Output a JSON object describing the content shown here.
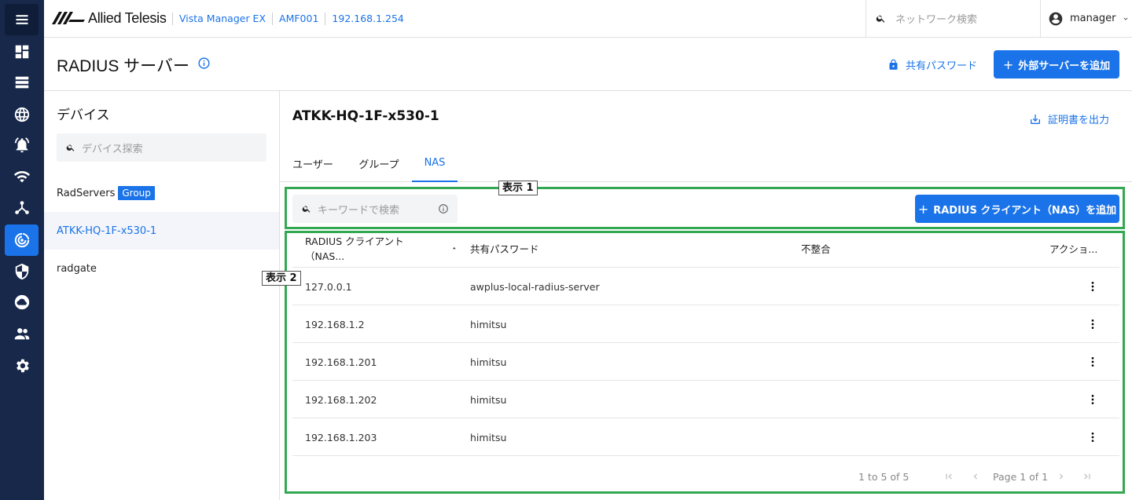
{
  "header": {
    "brand": "Allied Telesis",
    "breadcrumbs": [
      "Vista Manager EX",
      "AMF001",
      "192.168.1.254"
    ],
    "search_placeholder": "ネットワーク検索",
    "user_name": "manager"
  },
  "rail": {
    "icons": [
      "menu-icon",
      "dashboard-icon",
      "list-icon",
      "globe-icon",
      "alarm-icon",
      "wifi-icon",
      "topology-icon",
      "radius-icon",
      "shield-icon",
      "cloud-icon",
      "users-icon",
      "settings-icon"
    ],
    "active": "radius-icon"
  },
  "page": {
    "title": "RADIUS サーバー",
    "shared_password_label": "共有パスワード",
    "add_external_label": "外部サーバーを追加"
  },
  "devices": {
    "heading": "デバイス",
    "search_placeholder": "デバイス探索",
    "items": [
      {
        "label": "RadServers",
        "badge": "Group"
      },
      {
        "label": "ATKK-HQ-1F-x530-1",
        "badge": ""
      },
      {
        "label": "radgate",
        "badge": ""
      }
    ],
    "selected": "ATKK-HQ-1F-x530-1"
  },
  "detail": {
    "title": "ATKK-HQ-1F-x530-1",
    "export_label": "証明書を出力",
    "tabs": [
      "ユーザー",
      "グループ",
      "NAS"
    ],
    "active_tab": "NAS",
    "keyword_placeholder": "キーワードで検索",
    "add_client_label": "RADIUS クライアント（NAS）を追加",
    "callout1": "表示 1",
    "callout2": "表示 2",
    "columns": [
      "RADIUS クライアント（NAS...",
      "共有パスワード",
      "不整合",
      "アクショ..."
    ],
    "rows": [
      {
        "client": "127.0.0.1",
        "password": "awplus-local-radius-server",
        "mismatch": ""
      },
      {
        "client": "192.168.1.2",
        "password": "himitsu",
        "mismatch": ""
      },
      {
        "client": "192.168.1.201",
        "password": "himitsu",
        "mismatch": ""
      },
      {
        "client": "192.168.1.202",
        "password": "himitsu",
        "mismatch": ""
      },
      {
        "client": "192.168.1.203",
        "password": "himitsu",
        "mismatch": ""
      }
    ],
    "pagination": {
      "summary": "1 to 5 of 5",
      "page_text": "Page 1 of 1"
    }
  },
  "colors": {
    "accent": "#1a73e8",
    "rail": "#17284a",
    "highlight_box": "#33a853"
  }
}
